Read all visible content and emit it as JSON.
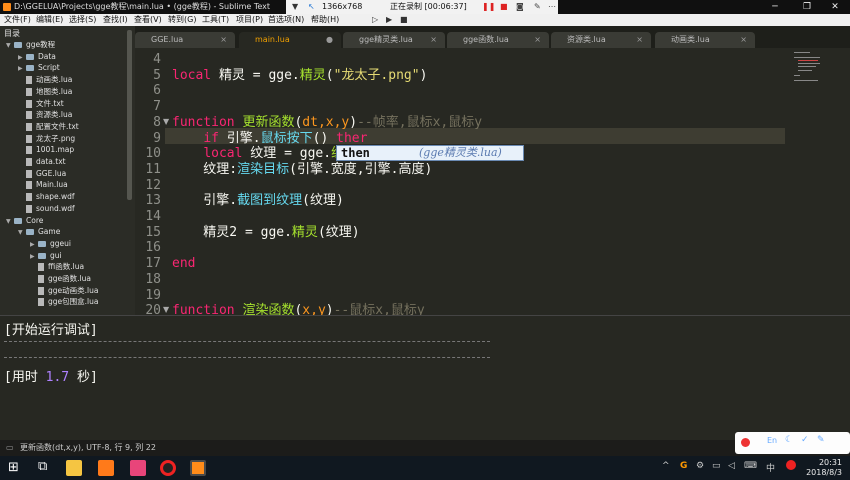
{
  "window": {
    "title": "D:\\GGELUA\\Projects\\gge教程\\main.lua • (gge教程) - Sublime Text"
  },
  "recorder": {
    "resolution": "1366x768",
    "status": "正在录制 [00:06:37]"
  },
  "menu": [
    "文件(F)",
    "编辑(E)",
    "选择(S)",
    "查找(I)",
    "查看(V)",
    "转到(G)",
    "工具(T)",
    "项目(P)",
    "首选项(N)",
    "帮助(H)"
  ],
  "tabs": [
    "GGE.lua",
    "main.lua",
    "gge精灵类.lua",
    "gge函数.lua",
    "资源类.lua",
    "动画类.lua"
  ],
  "sidebar": {
    "header": "目录",
    "items": [
      {
        "label": "gge教程",
        "type": "folder",
        "depth": 0,
        "open": true
      },
      {
        "label": "Data",
        "type": "folder",
        "depth": 1
      },
      {
        "label": "Script",
        "type": "folder",
        "depth": 1
      },
      {
        "label": "动画类.lua",
        "type": "file",
        "depth": 1
      },
      {
        "label": "地图类.lua",
        "type": "file",
        "depth": 1
      },
      {
        "label": "文件.txt",
        "type": "file",
        "depth": 1
      },
      {
        "label": "资源类.lua",
        "type": "file",
        "depth": 1
      },
      {
        "label": "配置文件.txt",
        "type": "file",
        "depth": 1
      },
      {
        "label": "龙太子.png",
        "type": "file",
        "depth": 1
      },
      {
        "label": "1001.map",
        "type": "file",
        "depth": 1
      },
      {
        "label": "data.txt",
        "type": "file",
        "depth": 1
      },
      {
        "label": "GGE.lua",
        "type": "file",
        "depth": 1
      },
      {
        "label": "Main.lua",
        "type": "file",
        "depth": 1
      },
      {
        "label": "shape.wdf",
        "type": "file",
        "depth": 1
      },
      {
        "label": "sound.wdf",
        "type": "file",
        "depth": 1
      },
      {
        "label": "Core",
        "type": "folder",
        "depth": 0,
        "open": true
      },
      {
        "label": "Game",
        "type": "folder",
        "depth": 1,
        "open": true
      },
      {
        "label": "ggeui",
        "type": "folder",
        "depth": 2
      },
      {
        "label": "gui",
        "type": "folder",
        "depth": 2
      },
      {
        "label": "ffi函数.lua",
        "type": "file",
        "depth": 2
      },
      {
        "label": "gge函数.lua",
        "type": "file",
        "depth": 2
      },
      {
        "label": "gge动画类.lua",
        "type": "file",
        "depth": 2
      },
      {
        "label": "gge包围盒.lua",
        "type": "file",
        "depth": 2
      }
    ]
  },
  "editor": {
    "line_numbers": [
      "4",
      "5",
      "6",
      "7",
      "8",
      "9",
      "10",
      "11",
      "12",
      "13",
      "14",
      "15",
      "16",
      "17",
      "18",
      "19",
      "20"
    ],
    "lines": [
      [],
      [
        {
          "c": "kw",
          "t": "local "
        },
        {
          "c": "pl",
          "t": "精灵 = gge."
        },
        {
          "c": "fn",
          "t": "精灵"
        },
        {
          "c": "pl",
          "t": "("
        },
        {
          "c": "st",
          "t": "\"龙太子.png\""
        },
        {
          "c": "pl",
          "t": ")"
        }
      ],
      [],
      [],
      [
        {
          "c": "kw",
          "t": "function "
        },
        {
          "c": "fn",
          "t": "更新函数"
        },
        {
          "c": "pl",
          "t": "("
        },
        {
          "c": "or",
          "t": "dt,x,y"
        },
        {
          "c": "pl",
          "t": ")"
        },
        {
          "c": "cm",
          "t": "--帧率,鼠标x,鼠标y"
        }
      ],
      [
        {
          "c": "pl",
          "t": "    "
        },
        {
          "c": "kw",
          "t": "if "
        },
        {
          "c": "pl",
          "t": "引擎."
        },
        {
          "c": "bl",
          "t": "鼠标按下"
        },
        {
          "c": "pl",
          "t": "() "
        },
        {
          "c": "kw",
          "t": "ther"
        }
      ],
      [
        {
          "c": "pl",
          "t": "    "
        },
        {
          "c": "kw",
          "t": "local "
        },
        {
          "c": "pl",
          "t": "纹理 = gge."
        },
        {
          "c": "fn",
          "t": "纹"
        }
      ],
      [
        {
          "c": "pl",
          "t": "    纹理:"
        },
        {
          "c": "bl",
          "t": "渲染目标"
        },
        {
          "c": "pl",
          "t": "(引擎.宽度,引擎.高度)"
        }
      ],
      [],
      [
        {
          "c": "pl",
          "t": "    引擎."
        },
        {
          "c": "bl",
          "t": "截图到纹理"
        },
        {
          "c": "pl",
          "t": "(纹理)"
        }
      ],
      [],
      [
        {
          "c": "pl",
          "t": "    精灵2 = gge."
        },
        {
          "c": "fn",
          "t": "精灵"
        },
        {
          "c": "pl",
          "t": "(纹理)"
        }
      ],
      [],
      [
        {
          "c": "kw",
          "t": "end"
        }
      ],
      [],
      [],
      [
        {
          "c": "kw",
          "t": "function "
        },
        {
          "c": "fn",
          "t": "渲染函数"
        },
        {
          "c": "pl",
          "t": "("
        },
        {
          "c": "or",
          "t": "x,y"
        },
        {
          "c": "pl",
          "t": ")"
        },
        {
          "c": "cm",
          "t": "--鼠标x,鼠标y"
        }
      ]
    ],
    "autocomplete": {
      "word": "then",
      "hint": "(gge精灵类.lua)"
    }
  },
  "console": {
    "start": "[开始运行调试]",
    "time_prefix": "[用时 ",
    "time_value": "1.7",
    "time_suffix": " 秒]"
  },
  "statusbar": {
    "text": "更新函数(dt,x,y), UTF-8, 行 9, 列 22"
  },
  "taskbar": {
    "time": "20:31",
    "date": "2018/8/3"
  },
  "colors": {
    "accent": "#f0a000",
    "keyword": "#f92672",
    "function": "#a6e22e",
    "string": "#e6db74",
    "comment": "#75715e"
  }
}
